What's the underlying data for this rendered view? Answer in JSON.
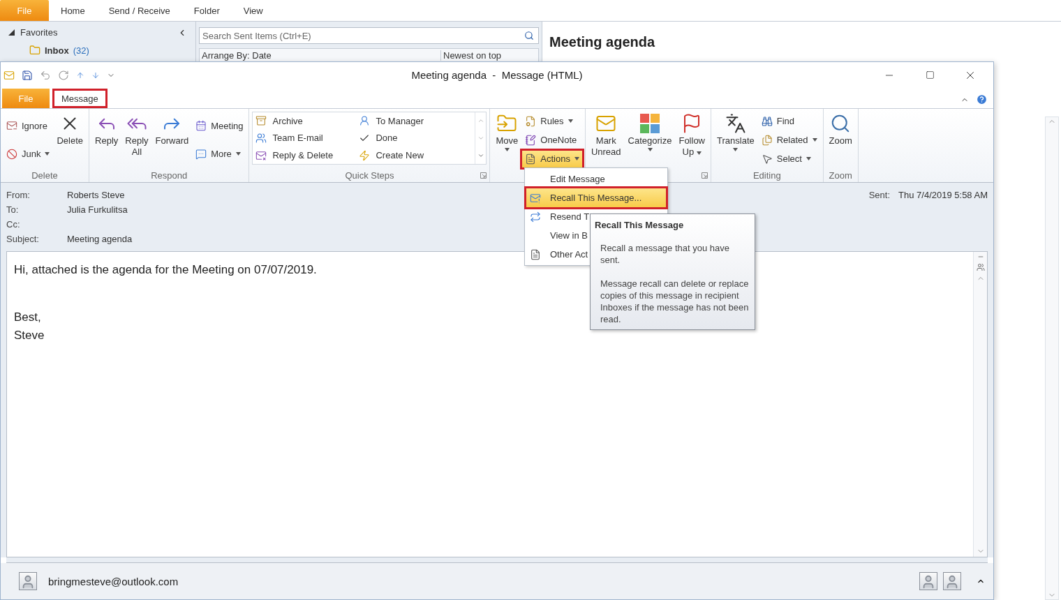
{
  "app_tabs": [
    {
      "label": "File",
      "kind": "file"
    },
    {
      "label": "Home",
      "kind": "tab"
    },
    {
      "label": "Send / Receive",
      "kind": "tab"
    },
    {
      "label": "Folder",
      "kind": "tab"
    },
    {
      "label": "View",
      "kind": "tab"
    }
  ],
  "favorites": {
    "label": "Favorites",
    "items": [
      {
        "name": "Inbox",
        "count": "(32)"
      }
    ]
  },
  "search": {
    "placeholder": "Search Sent Items (Ctrl+E)"
  },
  "arrange": {
    "label": "Arrange By: Date",
    "order": "Newest on top"
  },
  "reading_pane": {
    "title": "Meeting agenda"
  },
  "message_window": {
    "title": "Meeting agenda  -  Message (HTML)",
    "tabs": [
      {
        "label": "File",
        "kind": "file",
        "selected": false,
        "annotated": false
      },
      {
        "label": "Message",
        "kind": "tab",
        "selected": true,
        "annotated": true
      }
    ],
    "ribbon": {
      "groups": [
        {
          "label": "Delete",
          "columns": [
            [
              {
                "label": "Ignore",
                "kind": "small",
                "dropdown": false
              },
              {
                "label": "Junk",
                "kind": "small",
                "dropdown": true
              }
            ],
            [
              {
                "label": "Delete",
                "kind": "large",
                "dropdown": false
              }
            ]
          ]
        },
        {
          "label": "Respond",
          "columns": [
            [
              {
                "label": "Reply",
                "kind": "large",
                "dropdown": false
              }
            ],
            [
              {
                "label": "Reply\nAll",
                "kind": "large",
                "dropdown": false
              }
            ],
            [
              {
                "label": "Forward",
                "kind": "large",
                "dropdown": false
              }
            ],
            [
              {
                "label": "Meeting",
                "kind": "small",
                "dropdown": false
              },
              {
                "label": "More",
                "kind": "small",
                "dropdown": true
              }
            ]
          ]
        },
        {
          "label": "Quick Steps",
          "kind": "gallery",
          "launcher": true,
          "items": [
            {
              "label": "Archive"
            },
            {
              "label": "Team E-mail"
            },
            {
              "label": "Reply & Delete"
            },
            {
              "label": "To Manager"
            },
            {
              "label": "Done"
            },
            {
              "label": "Create New"
            }
          ]
        },
        {
          "columns": [
            [
              {
                "label": "Move",
                "kind": "large",
                "dropdown": true
              }
            ],
            [
              {
                "label": "Rules",
                "kind": "small",
                "dropdown": true
              },
              {
                "label": "OneNote",
                "kind": "small",
                "dropdown": false
              },
              {
                "label": "Actions",
                "kind": "small",
                "dropdown": true,
                "selected": true,
                "annotated": true
              }
            ]
          ]
        },
        {
          "launcher": true,
          "columns": [
            [
              {
                "label": "Mark\nUnread",
                "kind": "large",
                "dropdown": false
              }
            ],
            [
              {
                "label": "Categorize",
                "kind": "large",
                "dropdown": true
              }
            ],
            [
              {
                "label": "Follow\nUp",
                "kind": "large",
                "dropdown": true
              }
            ]
          ]
        },
        {
          "label": "Editing",
          "columns": [
            [
              {
                "label": "Translate",
                "kind": "large",
                "dropdown": true
              }
            ],
            [
              {
                "label": "Find",
                "kind": "small",
                "dropdown": false
              },
              {
                "label": "Related",
                "kind": "small",
                "dropdown": true
              },
              {
                "label": "Select",
                "kind": "small",
                "dropdown": true
              }
            ]
          ]
        },
        {
          "label": "Zoom",
          "columns": [
            [
              {
                "label": "Zoom",
                "kind": "large",
                "dropdown": false
              }
            ]
          ]
        }
      ]
    },
    "header": {
      "fields": [
        {
          "label": "From:",
          "value": "Roberts Steve"
        },
        {
          "label": "To:",
          "value": "Julia Furkulitsa"
        },
        {
          "label": "Cc:"
        },
        {
          "label": "Subject:",
          "value": "Meeting agenda"
        }
      ],
      "sent": {
        "label": "Sent:",
        "value": "Thu 7/4/2019 5:58 AM"
      }
    },
    "body": {
      "paragraphs": [
        {
          "lines": [
            "Hi, attached is the agenda for the Meeting on 07/07/2019."
          ]
        },
        {
          "lines": [
            "Best,",
            "Steve"
          ]
        }
      ]
    },
    "people": {
      "email": "bringmesteve@outlook.com"
    },
    "actions_menu": {
      "items": [
        {
          "label": "Edit Message",
          "selected": false,
          "annotated": false
        },
        {
          "label": "Recall This Message...",
          "selected": true,
          "annotated": true
        },
        {
          "label": "Resend T",
          "selected": false,
          "annotated": false
        },
        {
          "label": "View in B",
          "selected": false,
          "annotated": false
        },
        {
          "label": "Other Act",
          "selected": false,
          "annotated": false
        }
      ]
    },
    "tooltip": {
      "title": "Recall This Message",
      "paragraphs": [
        "Recall a message that you have sent.",
        "Message recall can delete or replace copies of this message in recipient Inboxes if the message has not been read."
      ]
    }
  }
}
